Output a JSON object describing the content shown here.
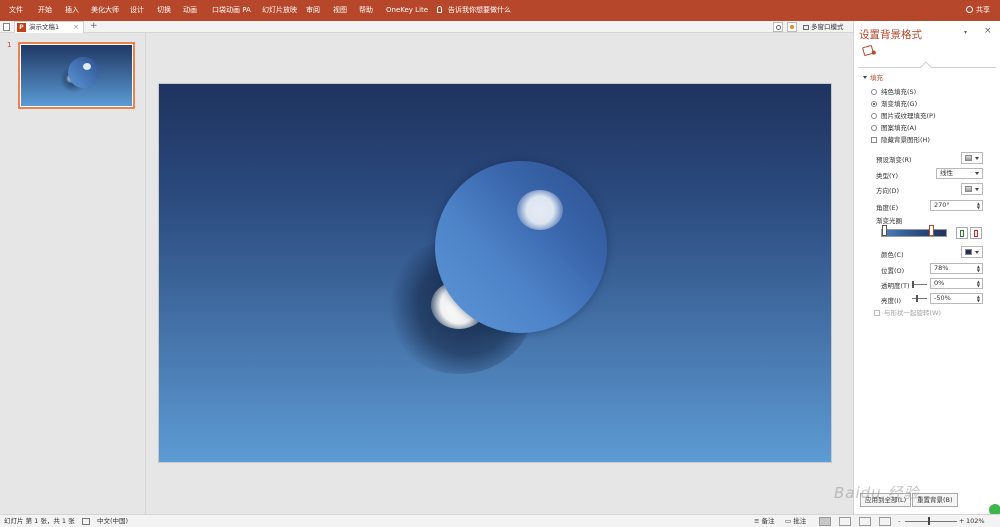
{
  "ribbon": {
    "tabs": [
      "文件",
      "开始",
      "插入",
      "美化大师",
      "设计",
      "切换",
      "动画",
      "口袋动画 PA",
      "幻灯片放映",
      "审阅",
      "视图",
      "帮助",
      "OneKey Lite"
    ],
    "tell_me": "告诉我你想要做什么",
    "share": "共享",
    "bg_color": "#b7472a"
  },
  "docbar": {
    "doc_name": "演示文稿1",
    "close_glyph": "×",
    "new_tab_glyph": "+",
    "multi_window": "多窗口模式",
    "ppt_glyph": "P"
  },
  "thumbnails": {
    "slide_number": "1"
  },
  "pane": {
    "title": "设置背景格式",
    "dropdown_glyph": "▾",
    "close_glyph": "×",
    "section": "填充",
    "fill_options": [
      {
        "label": "纯色填充(S)",
        "selected": false
      },
      {
        "label": "渐变填充(G)",
        "selected": true
      },
      {
        "label": "图片或纹理填充(P)",
        "selected": false
      },
      {
        "label": "图案填充(A)",
        "selected": false
      }
    ],
    "hide_bg": "隐藏背景图形(H)",
    "preset_label": "预设渐变(R)",
    "type_label": "类型(Y)",
    "type_value": "线性",
    "direction_label": "方向(D)",
    "angle_label": "角度(E)",
    "angle_value": "270°",
    "stops_label": "渐变光圈",
    "color_label": "颜色(C)",
    "position_label": "位置(O)",
    "position_value": "78%",
    "transparency_label": "透明度(T)",
    "transparency_value": "0%",
    "brightness_label": "亮度(I)",
    "brightness_value": "-50%",
    "rotate_label": "与形状一起旋转(W)",
    "apply_all": "应用到全部(L)",
    "reset": "重置背景(B)"
  },
  "status": {
    "slide_info": "幻灯片 第 1 张，共 1 张",
    "language": "中文(中国)",
    "notes": "备注",
    "comments": "批注",
    "zoom": "102%",
    "minus": "-",
    "plus": "+"
  },
  "watermark": "Baidu 经验",
  "colors": {
    "accent": "#b7472a",
    "slide_top": "#1f335f",
    "slide_bottom": "#5d9bd4"
  }
}
